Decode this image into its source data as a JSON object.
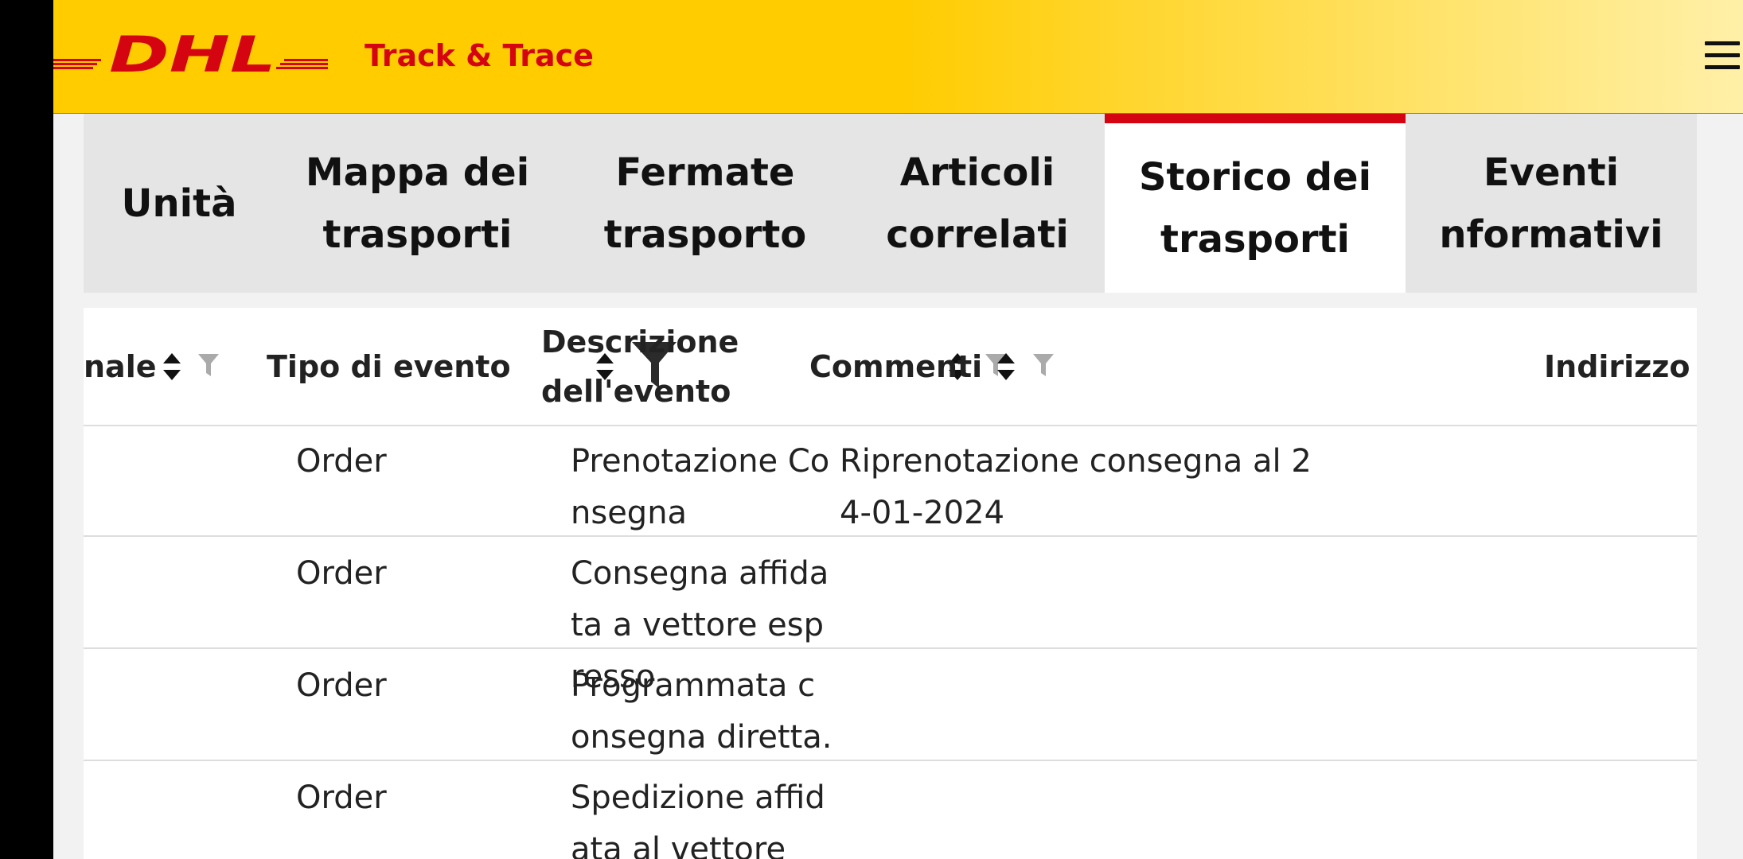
{
  "header": {
    "brand_logo_text": "DHL",
    "title": "Track & Trace",
    "menu_icon": "hamburger-menu-icon"
  },
  "colors": {
    "brand_yellow": "#ffcc00",
    "brand_red": "#d40511",
    "tab_background": "#e5e5e5"
  },
  "tabs": [
    {
      "label": "Unità",
      "active": false
    },
    {
      "label": "Mappa dei\ntrasporti",
      "active": false
    },
    {
      "label": "Fermate\ntrasporto",
      "active": false
    },
    {
      "label": "Articoli\ncorrelati",
      "active": false
    },
    {
      "label": "Storico dei\ntrasporti",
      "active": true
    },
    {
      "label": "Eventi\nnformativi",
      "active": false
    }
  ],
  "table": {
    "columns": [
      {
        "label": "nale",
        "sortable": true,
        "filter": "funnel-icon",
        "filter_active": false
      },
      {
        "label": "Tipo di evento",
        "sortable": true,
        "filter": "funnel-icon",
        "filter_active": true
      },
      {
        "label": "Descrizione\ndell'evento",
        "sortable": true,
        "filter": "funnel-icon",
        "filter_active": false
      },
      {
        "label": "Commenti",
        "sortable": true,
        "filter": "funnel-icon",
        "filter_active": false
      },
      {
        "label": "Indirizzo",
        "sortable": false
      }
    ],
    "rows": [
      {
        "type": "Order",
        "description": "Prenotazione Consegna",
        "comment": "Riprenotazione consegna al 24-01-2024"
      },
      {
        "type": "Order",
        "description": "Consegna affidata a vettore espresso",
        "comment": ""
      },
      {
        "type": "Order",
        "description": "Programmata consegna diretta.",
        "comment": ""
      },
      {
        "type": "Order",
        "description": "Spedizione affidata al vettore",
        "comment": ""
      }
    ]
  }
}
